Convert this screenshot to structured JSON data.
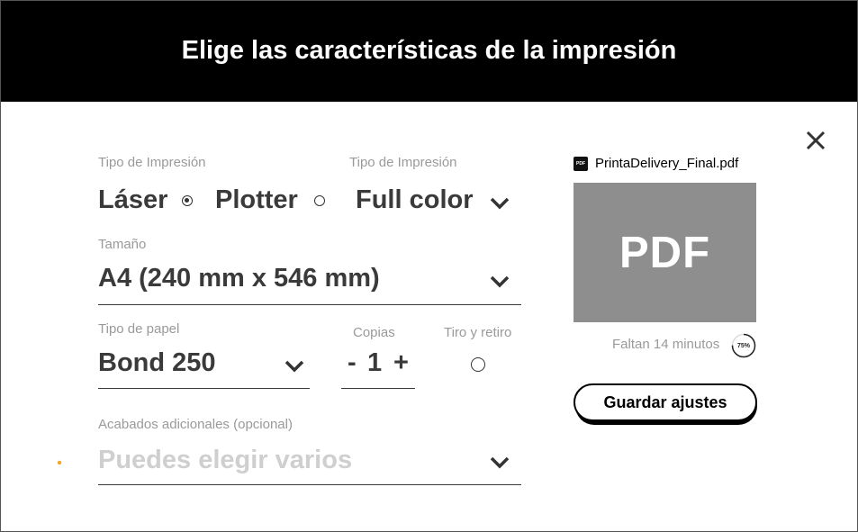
{
  "header": {
    "title": "Elige las características de la impresión"
  },
  "print_type": {
    "label": "Tipo de Impresión",
    "options": [
      {
        "label": "Láser",
        "selected": true
      },
      {
        "label": "Plotter",
        "selected": false
      }
    ]
  },
  "color": {
    "label": "Tipo de Impresión",
    "value": "Full color"
  },
  "size": {
    "label": "Tamaño",
    "value": "A4 (240 mm x 546 mm)"
  },
  "paper": {
    "label": "Tipo de papel",
    "value": "Bond 250"
  },
  "copies": {
    "label": "Copias",
    "minus": "-",
    "value": "1",
    "plus": "+"
  },
  "duplex": {
    "label": "Tiro y retiro",
    "checked": false
  },
  "finishes": {
    "label": "Acabados adicionales (opcional)",
    "placeholder": "Puedes elegir varios"
  },
  "file": {
    "icon_text": "PDF",
    "name": "PrintaDelivery_Final.pdf",
    "preview_text": "PDF",
    "time_left": "Faltan 14 minutos",
    "progress_label": "75%",
    "progress": 0.75
  },
  "actions": {
    "save_label": "Guardar ajustes"
  },
  "colors": {
    "header_bg": "#000000",
    "preview_bg": "#8e8e8e",
    "bullet": "#f5a623"
  },
  "icons": {
    "close": "close-icon",
    "chevron": "chevron-down-icon",
    "pdf": "pdf-file-icon"
  }
}
